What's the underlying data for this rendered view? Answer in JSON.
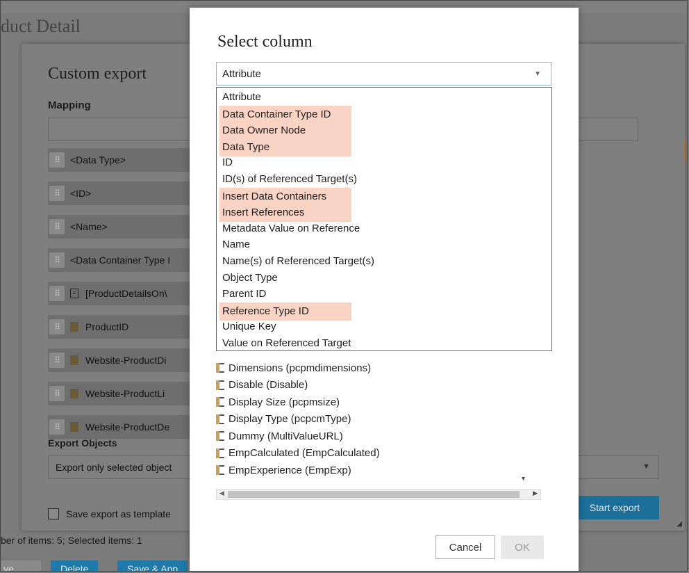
{
  "background_page": {
    "title_fragment": "duct Detail",
    "status_text": "ber of items: 5; Selected items: 1",
    "buttons": [
      "ve",
      "Delete",
      "Save & App"
    ]
  },
  "custom_export": {
    "title": "Custom export",
    "mapping_label": "Mapping",
    "rows": [
      {
        "icon": "none",
        "label": "<Data Type>"
      },
      {
        "icon": "none",
        "label": "<ID>"
      },
      {
        "icon": "none",
        "label": "<Name>"
      },
      {
        "icon": "none",
        "label": "<Data Container Type I"
      },
      {
        "icon": "document-icon",
        "label": "[ProductDetailsOn\\"
      },
      {
        "icon": "attribute-icon",
        "label": "ProductID"
      },
      {
        "icon": "attribute-icon",
        "label": "Website-ProductDi"
      },
      {
        "icon": "attribute-icon",
        "label": "Website-ProductLi"
      },
      {
        "icon": "attribute-icon",
        "label": "Website-ProductDe"
      }
    ],
    "export_objects_label": "Export Objects",
    "export_objects_value": "Export only selected object",
    "save_template_label": "Save export as template",
    "start_export_label": "Start export"
  },
  "select_column": {
    "title": "Select column",
    "combo_value": "Attribute",
    "dropdown_items": [
      {
        "label": "Attribute",
        "highlighted": false
      },
      {
        "label": "Data Container Type ID",
        "highlighted": true
      },
      {
        "label": "Data Owner Node",
        "highlighted": true
      },
      {
        "label": "Data Type",
        "highlighted": true
      },
      {
        "label": "ID",
        "highlighted": false
      },
      {
        "label": "ID(s) of Referenced Target(s)",
        "highlighted": false
      },
      {
        "label": "Insert Data Containers",
        "highlighted": true
      },
      {
        "label": "Insert References",
        "highlighted": true
      },
      {
        "label": "Metadata Value on Reference",
        "highlighted": false
      },
      {
        "label": "Name",
        "highlighted": false
      },
      {
        "label": "Name(s) of Referenced Target(s)",
        "highlighted": false
      },
      {
        "label": "Object Type",
        "highlighted": false
      },
      {
        "label": "Parent ID",
        "highlighted": false
      },
      {
        "label": "Reference Type ID",
        "highlighted": true
      },
      {
        "label": "Unique Key",
        "highlighted": false
      },
      {
        "label": "Value on Referenced Target",
        "highlighted": false
      }
    ],
    "list_items": [
      "Dimensions (pcpmdimensions)",
      "Disable (Disable)",
      "Display Size (pcpmsize)",
      "Display Type (pcpcmType)",
      "Dummy (MultiValueURL)",
      "EmpCalculated (EmpCalculated)",
      "EmpExperience (EmpExp)"
    ],
    "cancel_label": "Cancel",
    "ok_label": "OK"
  },
  "colors": {
    "highlight": "#f9d4c5",
    "primary_button": "#1c6f99",
    "combo_border": "#8fb6cf"
  }
}
